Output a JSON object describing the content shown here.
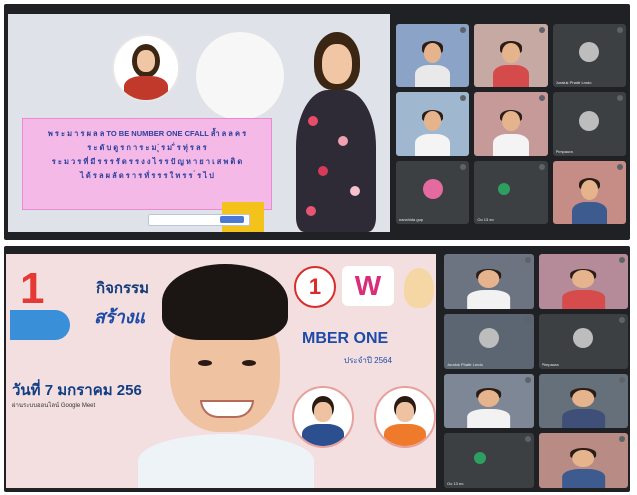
{
  "top_panel": {
    "slide": {
      "banner_lines": [
        "พ ร ะ ม า ร ผ ล ล TO BE NUMBER ONE CFALL ล้ำ ล ล ค ร",
        "ร ะ ดั บ ดู ร ก า  ร ะ ม ุ่ ร ม ั่ ร  ทุ่ ร ล ร",
        "ร ะ ม ว ร ที่ มี ร ร ร รั ด ร ร ง ง ไ ร ร ปั ญ ห า ย า เ ส พ ติ ด",
        "ไ ด้ ร ล ผ ลั ด  ร า ร ทั่ ร ร ร ใ ท ร ร ่ ร ไ ป"
      ]
    },
    "tiles": [
      {
        "label": "",
        "kind": "video"
      },
      {
        "label": "",
        "kind": "video"
      },
      {
        "label": "Juraluk Phattr Lmdo",
        "kind": "avatar"
      },
      {
        "label": "",
        "kind": "video"
      },
      {
        "label": "",
        "kind": "video"
      },
      {
        "label": "Pimpaura",
        "kind": "avatar"
      },
      {
        "label": "nanchida gup",
        "kind": "avatar"
      },
      {
        "label": "Oo 13 eo",
        "kind": "avatar"
      },
      {
        "label": "",
        "kind": "video"
      }
    ]
  },
  "bottom_panel": {
    "slide": {
      "number_badge": "1",
      "line1": "กิจกรรม",
      "line2": "สร้างแ",
      "line3": "MBER ONE",
      "line4": "ประจำปี 2564",
      "date": "วันที่ 7 มกราคม 256",
      "footnote": "ผ่านระบบออนไลน์ Google Meet",
      "logo1": "1",
      "logo2": "W"
    },
    "tiles": [
      {
        "label": "",
        "kind": "video"
      },
      {
        "label": "",
        "kind": "video"
      },
      {
        "label": "Juraluk Phattr Lmdo",
        "kind": "video"
      },
      {
        "label": "Pimpaura",
        "kind": "avatar"
      },
      {
        "label": "",
        "kind": "video"
      },
      {
        "label": "",
        "kind": "video"
      },
      {
        "label": "Oo 13 eo",
        "kind": "avatar"
      },
      {
        "label": "",
        "kind": "video"
      }
    ]
  }
}
